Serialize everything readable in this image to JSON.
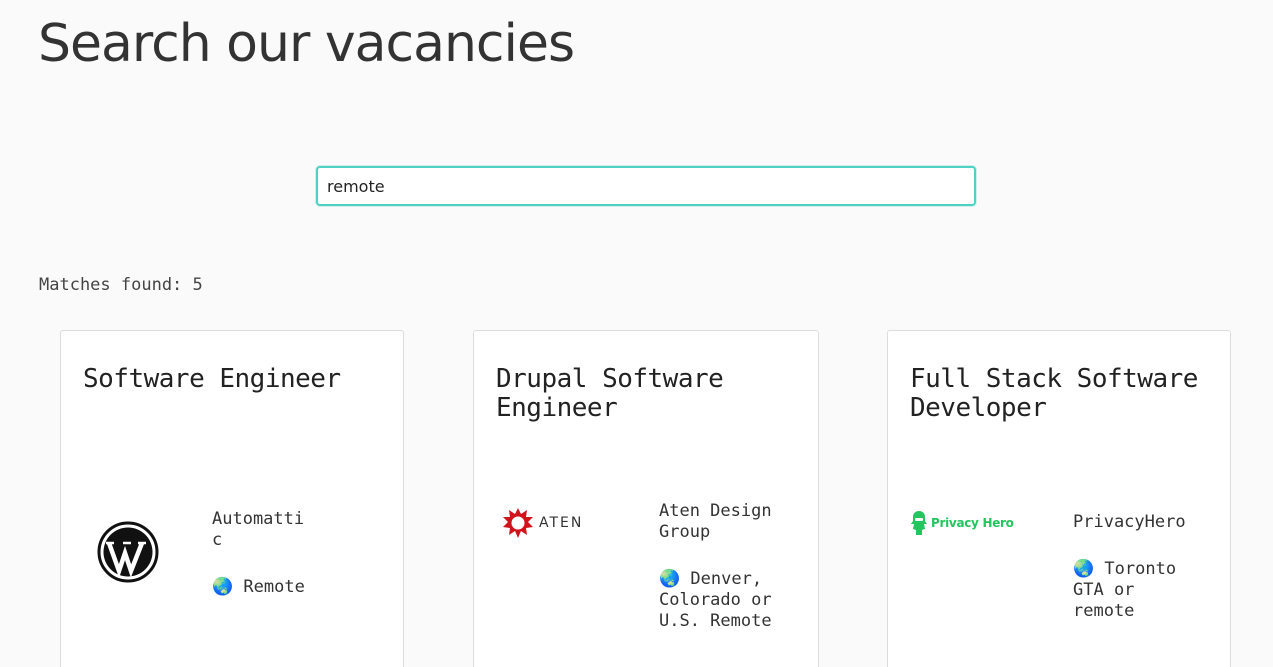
{
  "page": {
    "title": "Search our vacancies"
  },
  "search": {
    "value": "remote"
  },
  "results": {
    "matches_label": "Matches found: 5"
  },
  "jobs": [
    {
      "title": "Software Engineer",
      "company": "Automattic",
      "location": "Remote",
      "logo_icon": "wordpress-logo-icon"
    },
    {
      "title": "Drupal Software Engineer",
      "company": "Aten Design Group",
      "location": "Denver, Colorado or U.S. Remote",
      "logo_icon": "aten-logo-icon",
      "logo_text": "ATEN",
      "logo_color": "#d0141c"
    },
    {
      "title": "Full Stack Software Developer",
      "company": "PrivacyHero",
      "location": "Toronto GTA or remote",
      "logo_icon": "privacy-hero-logo-icon",
      "logo_text": "Privacy Hero",
      "logo_color": "#22c55e"
    }
  ],
  "icons": {
    "location": "globe-icon",
    "globe_glyph": "🌏"
  },
  "colors": {
    "accent": "#4fd1c5",
    "background": "#fafafa"
  }
}
